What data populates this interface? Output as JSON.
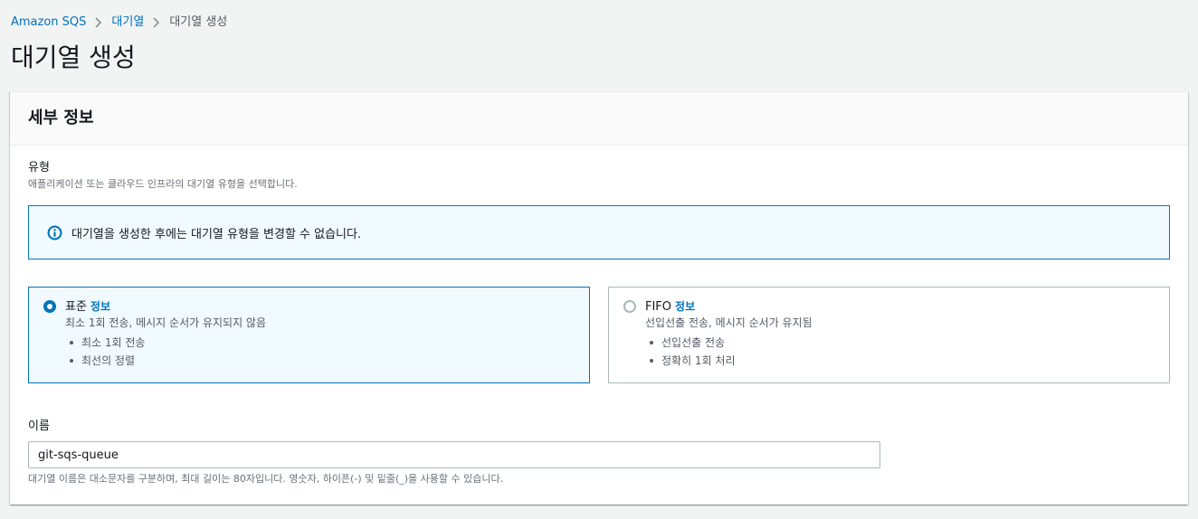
{
  "breadcrumb": {
    "items": [
      "Amazon SQS",
      "대기열"
    ],
    "current": "대기열 생성"
  },
  "page_title": "대기열 생성",
  "panel": {
    "title": "세부 정보",
    "type_label": "유형",
    "type_description": "애플리케이션 또는 클라우드 인프라의 대기열 유형을 선택합니다.",
    "alert": {
      "icon": "info-icon",
      "text": "대기열을 생성한 후에는 대기열 유형을 변경할 수 없습니다."
    },
    "options": [
      {
        "title": "표준",
        "info": "정보",
        "description": "최소 1회 전송, 메시지 순서가 유지되지 않음",
        "bullets": [
          "최소 1회 전송",
          "최선의 정렬"
        ],
        "selected": true
      },
      {
        "title": "FIFO",
        "info": "정보",
        "description": "선입선출 전송, 메시지 순서가 유지됨",
        "bullets": [
          "선입선출 전송",
          "정확히 1회 처리"
        ],
        "selected": false
      }
    ],
    "name_label": "이름",
    "name_value": "git-sqs-queue",
    "name_help": "대기열 이름은 대소문자를 구분하며, 최대 길이는 80자입니다. 영숫자, 하이픈(-) 및 밑줄(_)을 사용할 수 있습니다."
  },
  "colors": {
    "accent": "#0073bb",
    "background": "#f2f3f3",
    "selected_tile_bg": "#f1faff"
  }
}
